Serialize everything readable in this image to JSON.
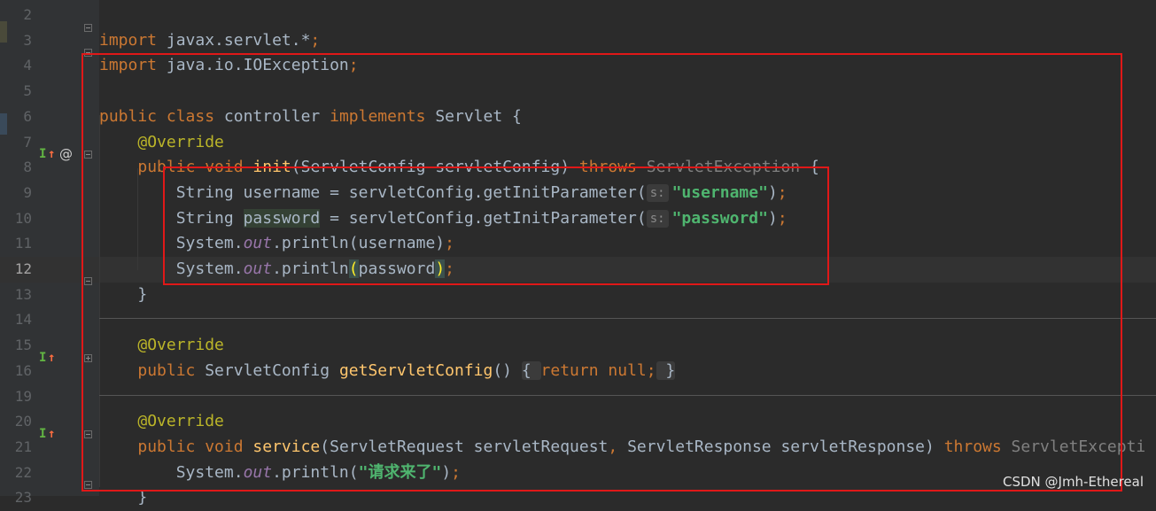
{
  "editor": {
    "lines": [
      {
        "num": "2",
        "segs": []
      },
      {
        "num": "3",
        "segs": [
          {
            "t": "import",
            "c": "kw"
          },
          {
            "t": " javax.servlet.*",
            "c": ""
          },
          {
            "t": ";",
            "c": "kw"
          }
        ]
      },
      {
        "num": "4",
        "segs": [
          {
            "t": "import",
            "c": "kw"
          },
          {
            "t": " java.io.IOException",
            "c": ""
          },
          {
            "t": ";",
            "c": "kw"
          }
        ]
      },
      {
        "num": "5",
        "segs": []
      },
      {
        "num": "6",
        "segs": [
          {
            "t": "public class ",
            "c": "kw"
          },
          {
            "t": "controller ",
            "c": ""
          },
          {
            "t": "implements ",
            "c": "kw"
          },
          {
            "t": "Servlet {",
            "c": ""
          }
        ]
      },
      {
        "num": "7",
        "segs": [
          {
            "t": "    ",
            "c": ""
          },
          {
            "t": "@Override",
            "c": "ann"
          }
        ]
      },
      {
        "num": "8",
        "segs": [
          {
            "t": "    ",
            "c": ""
          },
          {
            "t": "public void ",
            "c": "kw"
          },
          {
            "t": "init",
            "c": "fn"
          },
          {
            "t": "(ServletConfig servletConfig) ",
            "c": ""
          },
          {
            "t": "throws ",
            "c": "kw"
          },
          {
            "t": "ServletException",
            "c": "grey"
          },
          {
            "t": " {",
            "c": ""
          }
        ]
      },
      {
        "num": "9",
        "segs": [
          {
            "t": "        String username = servletConfig.getInitParameter(",
            "c": ""
          },
          {
            "t": "s:",
            "c": "hint"
          },
          {
            "t": "\"username\"",
            "c": "str2"
          },
          {
            "t": ")",
            "c": ""
          },
          {
            "t": ";",
            "c": "kw"
          }
        ]
      },
      {
        "num": "10",
        "segs": [
          {
            "t": "        String ",
            "c": ""
          },
          {
            "t": "password",
            "c": "var-hl"
          },
          {
            "t": " = servletConfig.getInitParameter(",
            "c": ""
          },
          {
            "t": "s:",
            "c": "hint"
          },
          {
            "t": "\"password\"",
            "c": "str2"
          },
          {
            "t": ")",
            "c": ""
          },
          {
            "t": ";",
            "c": "kw"
          }
        ]
      },
      {
        "num": "11",
        "segs": [
          {
            "t": "        System.",
            "c": ""
          },
          {
            "t": "out",
            "c": "sfld"
          },
          {
            "t": ".println(username)",
            "c": ""
          },
          {
            "t": ";",
            "c": "kw"
          }
        ]
      },
      {
        "num": "12",
        "segs": [
          {
            "t": "        System.",
            "c": ""
          },
          {
            "t": "out",
            "c": "sfld"
          },
          {
            "t": ".println",
            "c": ""
          },
          {
            "t": "(",
            "c": "brace-hl"
          },
          {
            "t": "password",
            "c": ""
          },
          {
            "t": ")",
            "c": "brace-hl"
          },
          {
            "t": ";",
            "c": "kw"
          }
        ]
      },
      {
        "num": "13",
        "segs": [
          {
            "t": "    }",
            "c": ""
          }
        ]
      },
      {
        "num": "14",
        "segs": []
      },
      {
        "num": "15",
        "segs": [
          {
            "t": "    ",
            "c": ""
          },
          {
            "t": "@Override",
            "c": "ann"
          }
        ]
      },
      {
        "num": "16",
        "segs": [
          {
            "t": "    ",
            "c": ""
          },
          {
            "t": "public ",
            "c": "kw"
          },
          {
            "t": "ServletConfig ",
            "c": ""
          },
          {
            "t": "getServletConfig",
            "c": "fn"
          },
          {
            "t": "() ",
            "c": ""
          },
          {
            "t": "{ ",
            "c": "fold-bg"
          },
          {
            "t": "return null;",
            "c": "kw"
          },
          {
            "t": " }",
            "c": "fold-bg"
          }
        ]
      },
      {
        "num": "19",
        "segs": []
      },
      {
        "num": "20",
        "segs": [
          {
            "t": "    ",
            "c": ""
          },
          {
            "t": "@Override",
            "c": "ann"
          }
        ]
      },
      {
        "num": "21",
        "segs": [
          {
            "t": "    ",
            "c": ""
          },
          {
            "t": "public void ",
            "c": "kw"
          },
          {
            "t": "service",
            "c": "fn"
          },
          {
            "t": "(ServletRequest servletRequest",
            "c": ""
          },
          {
            "t": ", ",
            "c": "kw"
          },
          {
            "t": "ServletResponse servletResponse) ",
            "c": ""
          },
          {
            "t": "throws ",
            "c": "kw"
          },
          {
            "t": "ServletExcepti",
            "c": "grey"
          }
        ]
      },
      {
        "num": "22",
        "segs": [
          {
            "t": "        System.",
            "c": ""
          },
          {
            "t": "out",
            "c": "sfld"
          },
          {
            "t": ".println(",
            "c": ""
          },
          {
            "t": "\"请求来了\"",
            "c": "str2"
          },
          {
            "t": ")",
            "c": ""
          },
          {
            "t": ";",
            "c": "kw"
          }
        ]
      },
      {
        "num": "23",
        "segs": [
          {
            "t": "    }",
            "c": ""
          }
        ]
      }
    ],
    "current_line": "12"
  },
  "gutter_icons": {
    "implements_icon": "I",
    "override_arrow_icon": "↑",
    "annotation_icon": "@"
  },
  "watermark": "CSDN @Jmh-Ethereal",
  "colors": {
    "background": "#2b2b2b",
    "gutter": "#313335",
    "keyword": "#cc7832",
    "annotation": "#bbb529",
    "method": "#ffc66d",
    "string": "#4fb56f",
    "highlight_box": "#e01818"
  }
}
